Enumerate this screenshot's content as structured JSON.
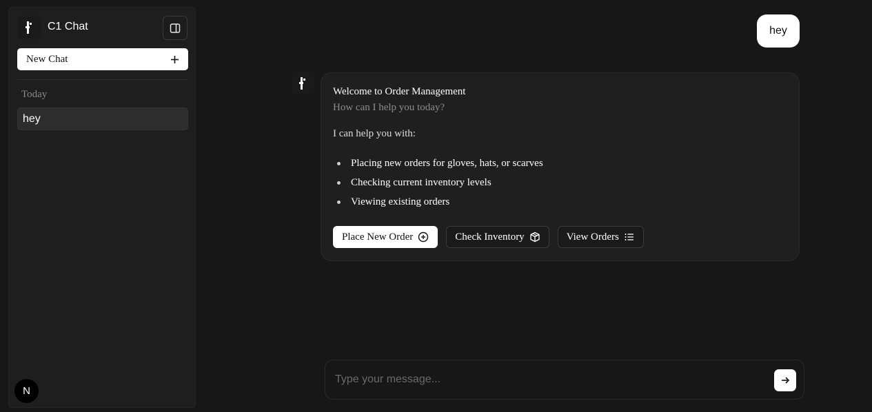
{
  "sidebar": {
    "brand_title": "C1 Chat",
    "new_chat_label": "New Chat",
    "section_label": "Today",
    "history": [
      {
        "label": "hey"
      }
    ],
    "avatar_letter": "N"
  },
  "conversation": {
    "user_message": "hey",
    "assistant": {
      "title": "Welcome to Order Management",
      "subtitle": "How can I help you today?",
      "intro": "I can help you with:",
      "items": [
        "Placing new orders for gloves, hats, or scarves",
        "Checking current inventory levels",
        "Viewing existing orders"
      ],
      "actions": [
        {
          "label": "Place New Order",
          "icon": "plus-circle-icon"
        },
        {
          "label": "Check Inventory",
          "icon": "box-icon"
        },
        {
          "label": "View Orders",
          "icon": "list-icon"
        }
      ]
    }
  },
  "composer": {
    "placeholder": "Type your message...",
    "value": ""
  },
  "colors": {
    "background": "#171717",
    "sidebar": "#1e1e1e",
    "card": "#1f1f1f",
    "primary_button": "#ffffff"
  }
}
